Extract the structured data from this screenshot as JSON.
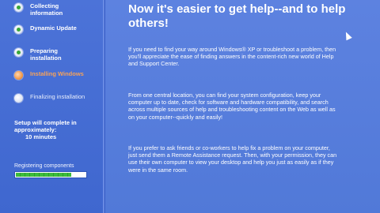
{
  "steps": [
    {
      "label": "Collecting information",
      "state": "done"
    },
    {
      "label": "Dynamic Update",
      "state": "done"
    },
    {
      "label": "Preparing installation",
      "state": "done"
    },
    {
      "label": "Installing Windows",
      "state": "active"
    },
    {
      "label": "Finalizing installation",
      "state": "pending"
    }
  ],
  "time_estimate": {
    "prefix": "Setup will complete in approximately:",
    "minutes": "10 minutes"
  },
  "status": {
    "label": "Registering components",
    "progress_fraction": 0.8
  },
  "main": {
    "headline": "Now it's easier to get help--and to help others!",
    "paragraphs": [
      "If you need to find your way around Windows® XP or troubleshoot a problem, then you'll appreciate the ease of finding answers in the content-rich new world of Help and Support Center.",
      "From one central location, you can find your system configuration, keep your computer up to date, check for software and hardware compatibility, and search across multiple sources of help and troubleshooting content on the Web as well as on your computer--quickly and easily!",
      "If you prefer to ask friends or co-workers to help fix a problem on your computer, just send them a Remote Assistance request. Then, with your permission, they can use their own computer to view your desktop and help you just as easily as if they were in the same room."
    ]
  },
  "colors": {
    "background": "#5a7edc",
    "sidebar": "#4c73d8",
    "active_step": "#f6a25a",
    "progress_fill": "#3cbc3c"
  }
}
